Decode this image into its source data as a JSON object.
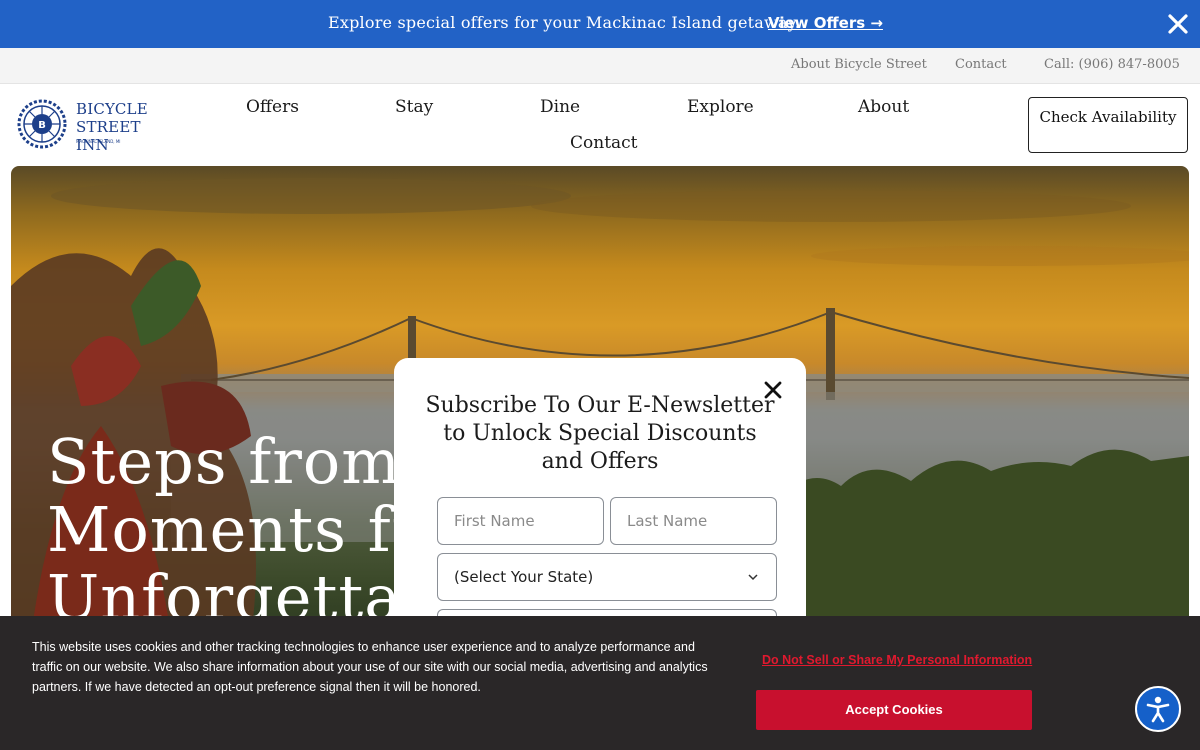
{
  "promo": {
    "text": "Explore special offers for your Mackinac Island getaway.",
    "link": "View Offers →",
    "close_icon": "close-icon"
  },
  "utility": {
    "about": "About Bicycle Street",
    "contact": "Contact",
    "phone": "Call: (906) 847-8005"
  },
  "logo": {
    "line1": "BICYCLE",
    "line2": "STREET INN",
    "line3": "MACKINAC ISLAND, MI",
    "icon": "bicycle-wheel-logo-icon"
  },
  "nav": {
    "offers": "Offers",
    "stay": "Stay",
    "dine": "Dine",
    "explore": "Explore",
    "about": "About",
    "contact": "Contact"
  },
  "check_availability": "Check Availability",
  "hero": {
    "line1": "Steps from",
    "line2": "Moments fr",
    "line3": "Unforgettal"
  },
  "modal": {
    "title": "Subscribe To Our E-Newsletter to Unlock Special Discounts and Offers",
    "first_name_placeholder": "First Name",
    "last_name_placeholder": "Last Name",
    "state_select": "(Select Your State)"
  },
  "cookie": {
    "text": "This website uses cookies and other tracking technologies to enhance user experience and to analyze performance and traffic on our website. We also share information about your use of our site with our social media, advertising and analytics partners. If we have detected an opt-out preference signal then it will be honored.",
    "dns_link": "Do Not Sell or Share My Personal Information",
    "accept": "Accept Cookies"
  },
  "colors": {
    "promo_bg": "#2262c6",
    "brand_blue": "#1d3f8a",
    "cookie_bg": "#2a2728",
    "accept_red": "#c8102e",
    "a11y_blue": "#1560c9"
  }
}
